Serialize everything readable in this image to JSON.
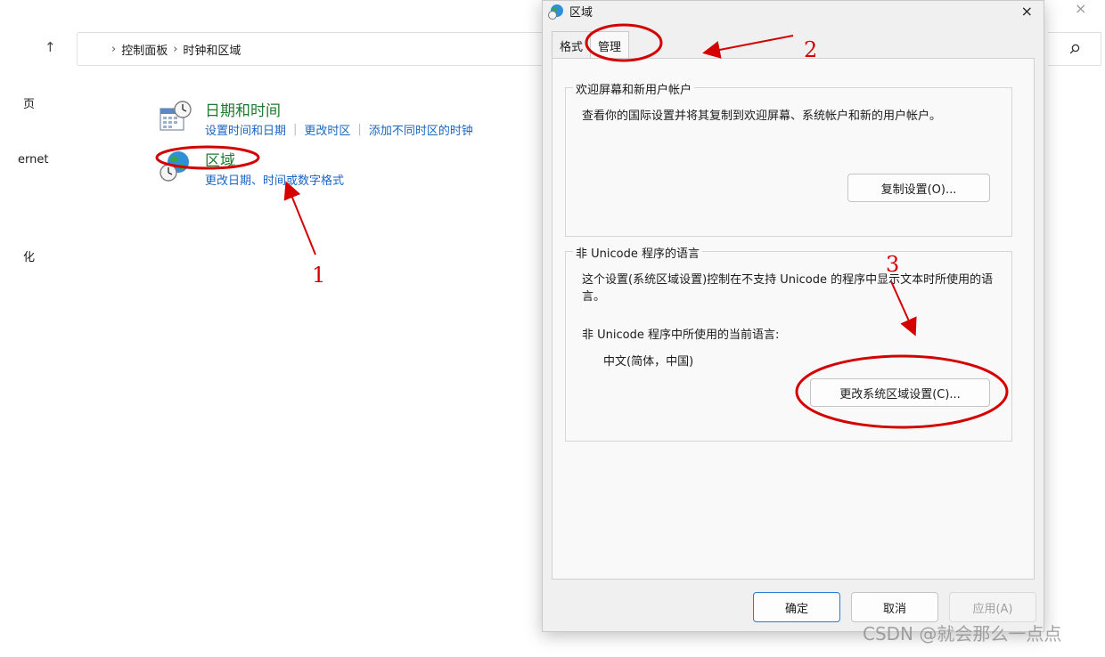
{
  "cp": {
    "up_icon": "↑",
    "breadcrumb": [
      "控制面板",
      "时钟和区域"
    ],
    "breadcrumb_sep": "›",
    "close_icon": "×",
    "left_nav": [
      "页",
      "ernet",
      "化"
    ],
    "datetime": {
      "title": "日期和时间",
      "links": [
        "设置时间和日期",
        "更改时区",
        "添加不同时区的时钟"
      ]
    },
    "region": {
      "title": "区域",
      "links": [
        "更改日期、时间或数字格式"
      ]
    }
  },
  "dialog": {
    "title": "区域",
    "close_icon": "×",
    "tabs": [
      "格式",
      "管理"
    ],
    "active_tab": "管理",
    "welcome_group": {
      "title": "欢迎屏幕和新用户帐户",
      "text": "查看你的国际设置并将其复制到欢迎屏幕、系统帐户和新的用户帐户。",
      "button": "复制设置(O)..."
    },
    "unicode_group": {
      "title": "非 Unicode 程序的语言",
      "text": "这个设置(系统区域设置)控制在不支持 Unicode 的程序中显示文本时所使用的语言。",
      "current_label": "非 Unicode 程序中所使用的当前语言:",
      "current_value": "中文(简体，中国)",
      "button": "更改系统区域设置(C)..."
    },
    "footer": {
      "ok": "确定",
      "cancel": "取消",
      "apply": "应用(A)"
    }
  },
  "annotations": {
    "color": "#d40000",
    "labels": [
      "1",
      "2",
      "3"
    ]
  },
  "watermark": "CSDN @就会那么一点点"
}
